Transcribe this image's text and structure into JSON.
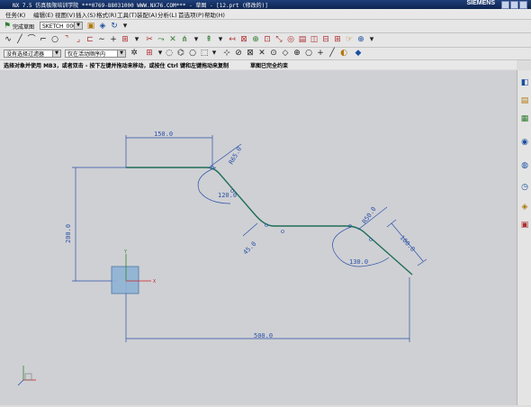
{
  "window": {
    "title": "NX 7.5 仿真极限培训学院   ***0769-88031000  WWW.NX76.COM***  - 草图 - [12.prt (修改的)]",
    "logo": "SIEMENS"
  },
  "menu": {
    "items": [
      "任务(K)",
      "编辑(E)",
      "视图(V)",
      "插入(S)",
      "格式(R)",
      "工具(T)",
      "装配(A)",
      "分析(L)",
      "首选项(P)",
      "帮助(H)"
    ]
  },
  "toolbar1": {
    "finish_label": "完成草图",
    "sketch_name": "SKETCH_000"
  },
  "toolbar3": {
    "filter": "没有选择过滤器",
    "scope": "仅在活动顺序内"
  },
  "status": {
    "prompt": "选择对象并使用 MB3，或者双击 - 按下左键并拖动来移动，或按住 Ctrl 键和左键拖动来复制",
    "state": "草图已完全约束"
  },
  "sketch": {
    "dimensions": {
      "top_length": "150.0",
      "total_length": "500.0",
      "height": "200.0",
      "r1": "R65.0",
      "angle1": "120.0",
      "chamfer_angle": "45.0",
      "r2": "R50.0",
      "angle2": "130.0",
      "end_length": "100.0"
    },
    "axis_labels": {
      "x": "X",
      "y": "Y"
    },
    "colors": {
      "curve": "#1e6e58",
      "dimension": "#2a52a8",
      "background": "#cfd0d4"
    }
  },
  "rightbar_icons": [
    "resource-bar-icon",
    "part-navigator-icon",
    "assembly-navigator-icon",
    "roles-icon",
    "web-browser-icon",
    "history-icon",
    "system-materials-icon",
    "palette-icon"
  ]
}
